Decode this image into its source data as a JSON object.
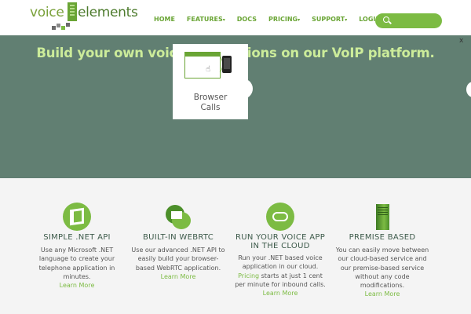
{
  "brand": {
    "part1": "voice",
    "part2": "elements"
  },
  "nav": {
    "items": [
      {
        "label": "HOME",
        "caret": ""
      },
      {
        "label": "FEATURES",
        "caret": "▾"
      },
      {
        "label": "DOCS",
        "caret": ""
      },
      {
        "label": "PRICING",
        "caret": "▾"
      },
      {
        "label": "SUPPORT",
        "caret": "▾"
      },
      {
        "label": "LOGIN",
        "caret": ""
      }
    ],
    "search_icon": "search-icon"
  },
  "hero": {
    "title": "Build your own voice applications on our VoIP platform.",
    "close": "x",
    "tile": {
      "line1": "Browser",
      "line2": "Calls"
    }
  },
  "features": [
    {
      "title": "SIMPLE .NET API",
      "desc1": "Use any Microsoft .NET",
      "desc2": "language to create your",
      "desc3": "telephone application in",
      "desc4": "minutes.",
      "link": "Learn More"
    },
    {
      "title": "BUILT-IN WEBRTC",
      "desc1": "Use our advanced .NET API to",
      "desc2": "easily build your browser-",
      "desc3": "based WebRTC application.",
      "link": "Learn More"
    },
    {
      "title_line1": "RUN YOUR VOICE APP",
      "title_line2": "IN THE CLOUD",
      "desc1": "Run your .NET based voice",
      "desc2": "application in our cloud.",
      "pricing_link": "Pricing",
      "desc3_rest": " starts at just 1 cent",
      "desc4": "per minute for inbound calls.",
      "link": "Learn More"
    },
    {
      "title": "PREMISE BASED",
      "desc1": "You can easily move between",
      "desc2": "our cloud-based service and",
      "desc3": "our premise-based service",
      "desc4": "without any code",
      "desc5": "modifications.",
      "link": "Learn More"
    }
  ],
  "colors": {
    "accent": "#7cbb43",
    "hero_bg": "#617f72",
    "hero_title": "#ccec9a"
  }
}
